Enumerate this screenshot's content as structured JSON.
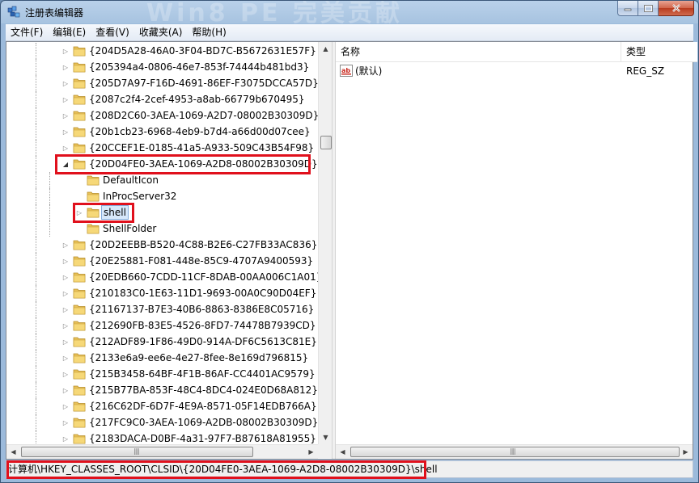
{
  "window": {
    "title": "注册表编辑器",
    "watermark": "Win8 PE 完美贡献",
    "accent": "#e0101c"
  },
  "menu": [
    "文件(F)",
    "编辑(E)",
    "查看(V)",
    "收藏夹(A)",
    "帮助(H)"
  ],
  "tree": {
    "items": [
      {
        "label": "{204D5A28-46A0-3F04-BD7C-B5672631E57F}",
        "level": 0,
        "arrow": "collapsed"
      },
      {
        "label": "{205394a4-0806-46e7-853f-74444b481bd3}",
        "level": 0,
        "arrow": "collapsed"
      },
      {
        "label": "{205D7A97-F16D-4691-86EF-F3075DCCA57D}",
        "level": 0,
        "arrow": "collapsed"
      },
      {
        "label": "{2087c2f4-2cef-4953-a8ab-66779b670495}",
        "level": 0,
        "arrow": "collapsed"
      },
      {
        "label": "{208D2C60-3AEA-1069-A2D7-08002B30309D}",
        "level": 0,
        "arrow": "collapsed"
      },
      {
        "label": "{20b1cb23-6968-4eb9-b7d4-a66d00d07cee}",
        "level": 0,
        "arrow": "collapsed"
      },
      {
        "label": "{20CCEF1E-0185-41a5-A933-509C43B54F98}",
        "level": 0,
        "arrow": "collapsed"
      },
      {
        "label": "{20D04FE0-3AEA-1069-A2D8-08002B30309D}",
        "level": 0,
        "arrow": "expanded",
        "highlight": true
      },
      {
        "label": "DefaultIcon",
        "level": 1,
        "arrow": "none"
      },
      {
        "label": "InProcServer32",
        "level": 1,
        "arrow": "none"
      },
      {
        "label": "shell",
        "level": 1,
        "arrow": "collapsed",
        "selected": true,
        "highlight": true
      },
      {
        "label": "ShellFolder",
        "level": 1,
        "arrow": "none"
      },
      {
        "label": "{20D2EEBB-B520-4C88-B2E6-C27FB33AC836}",
        "level": 0,
        "arrow": "collapsed"
      },
      {
        "label": "{20E25881-F081-448e-85C9-4707A9400593}",
        "level": 0,
        "arrow": "collapsed"
      },
      {
        "label": "{20EDB660-7CDD-11CF-8DAB-00AA006C1A01}",
        "level": 0,
        "arrow": "collapsed"
      },
      {
        "label": "{210183C0-1E63-11D1-9693-00A0C90D04EF}",
        "level": 0,
        "arrow": "collapsed"
      },
      {
        "label": "{21167137-B7E3-40B6-8863-8386E8C05716}",
        "level": 0,
        "arrow": "collapsed"
      },
      {
        "label": "{212690FB-83E5-4526-8FD7-74478B7939CD}",
        "level": 0,
        "arrow": "collapsed"
      },
      {
        "label": "{212ADF89-1F86-49D0-914A-DF6C5613C81E}",
        "level": 0,
        "arrow": "collapsed"
      },
      {
        "label": "{2133e6a9-ee6e-4e27-8fee-8e169d796815}",
        "level": 0,
        "arrow": "collapsed"
      },
      {
        "label": "{215B3458-64BF-4F1B-86AF-CC4401AC9579}",
        "level": 0,
        "arrow": "collapsed"
      },
      {
        "label": "{215B77BA-853F-48C4-8DC4-024E0D68A812}",
        "level": 0,
        "arrow": "collapsed"
      },
      {
        "label": "{216C62DF-6D7F-4E9A-8571-05F14EDB766A}",
        "level": 0,
        "arrow": "collapsed"
      },
      {
        "label": "{217FC9C0-3AEA-1069-A2DB-08002B30309D}",
        "level": 0,
        "arrow": "collapsed"
      },
      {
        "label": "{2183DACA-D0BF-4a31-97F7-B87618A81955}",
        "level": 0,
        "arrow": "collapsed"
      }
    ]
  },
  "list": {
    "col_name": "名称",
    "col_type": "类型",
    "rows": [
      {
        "name": "(默认)",
        "type": "REG_SZ",
        "icon": "string-value-icon"
      }
    ]
  },
  "status": {
    "path": "计算机\\HKEY_CLASSES_ROOT\\CLSID\\{20D04FE0-3AEA-1069-A2D8-08002B30309D}\\shell"
  }
}
